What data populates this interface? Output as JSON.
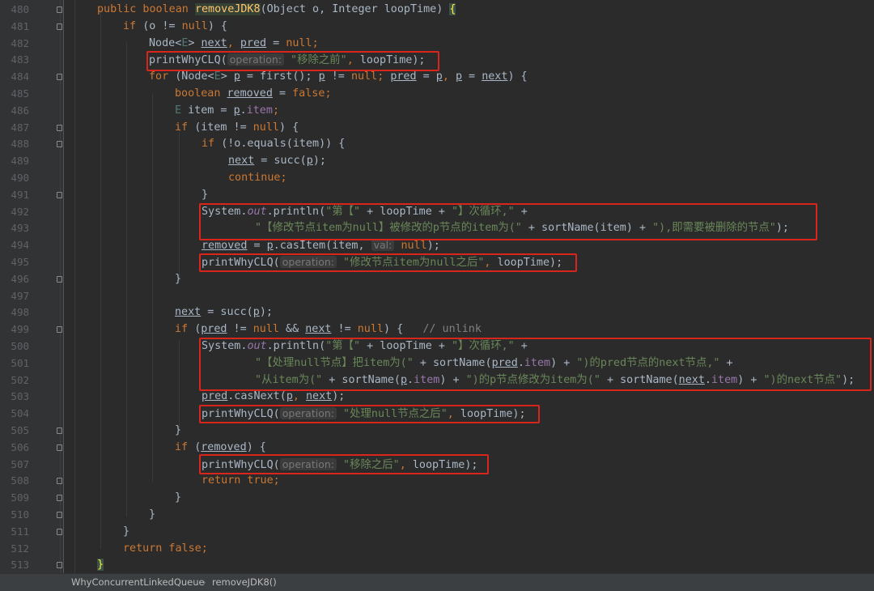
{
  "editor": {
    "lines": [
      {
        "num": "480",
        "segments": [
          {
            "t": "public boolean ",
            "c": "kw"
          },
          {
            "t": "removeJDK8",
            "c": "method hl"
          },
          {
            "t": "(Object o, Integer loopTime) ",
            "c": "ident"
          },
          {
            "t": "{",
            "c": "bracket"
          }
        ]
      },
      {
        "num": "481",
        "segments": [
          {
            "t": "if ",
            "c": "kw"
          },
          {
            "t": "(o != ",
            "c": "ident"
          },
          {
            "t": "null",
            "c": "kw"
          },
          {
            "t": ") {",
            "c": "ident"
          }
        ]
      },
      {
        "num": "482",
        "segments": [
          {
            "t": "Node<",
            "c": "ident"
          },
          {
            "t": "E",
            "c": "generic"
          },
          {
            "t": "> ",
            "c": "ident"
          },
          {
            "t": "next",
            "c": "ident ul"
          },
          {
            "t": ", ",
            "c": "kw"
          },
          {
            "t": "pred",
            "c": "ident ul"
          },
          {
            "t": " = ",
            "c": "ident"
          },
          {
            "t": "null",
            "c": "kw"
          },
          {
            "t": ";",
            "c": "kw"
          }
        ]
      },
      {
        "num": "483",
        "segments": [
          {
            "t": "printWhyCLQ(",
            "c": "ident"
          },
          {
            "t": "operation:",
            "c": "hint"
          },
          {
            "t": " ",
            "c": "ident"
          },
          {
            "t": "\"移除之前\"",
            "c": "str"
          },
          {
            "t": ", ",
            "c": "kw"
          },
          {
            "t": "loopTime);",
            "c": "ident"
          }
        ]
      },
      {
        "num": "484",
        "segments": [
          {
            "t": "for ",
            "c": "kw"
          },
          {
            "t": "(Node<",
            "c": "ident"
          },
          {
            "t": "E",
            "c": "generic"
          },
          {
            "t": "> ",
            "c": "ident"
          },
          {
            "t": "p",
            "c": "ident ul"
          },
          {
            "t": " = first(); ",
            "c": "ident"
          },
          {
            "t": "p",
            "c": "ident ul"
          },
          {
            "t": " != ",
            "c": "ident"
          },
          {
            "t": "null",
            "c": "kw"
          },
          {
            "t": "; ",
            "c": "kw"
          },
          {
            "t": "pred",
            "c": "ident ul"
          },
          {
            "t": " = ",
            "c": "ident"
          },
          {
            "t": "p",
            "c": "ident ul"
          },
          {
            "t": ", ",
            "c": "kw"
          },
          {
            "t": "p",
            "c": "ident ul"
          },
          {
            "t": " = ",
            "c": "ident"
          },
          {
            "t": "next",
            "c": "ident ul"
          },
          {
            "t": ") {",
            "c": "ident"
          }
        ]
      },
      {
        "num": "485",
        "segments": [
          {
            "t": "boolean ",
            "c": "kw"
          },
          {
            "t": "removed",
            "c": "ident ul"
          },
          {
            "t": " = ",
            "c": "ident"
          },
          {
            "t": "false",
            "c": "kw"
          },
          {
            "t": ";",
            "c": "kw"
          }
        ]
      },
      {
        "num": "486",
        "segments": [
          {
            "t": "E ",
            "c": "generic"
          },
          {
            "t": "item = ",
            "c": "ident"
          },
          {
            "t": "p",
            "c": "ident ul"
          },
          {
            "t": ".",
            "c": "ident"
          },
          {
            "t": "item",
            "c": "field"
          },
          {
            "t": ";",
            "c": "kw"
          }
        ]
      },
      {
        "num": "487",
        "segments": [
          {
            "t": "if ",
            "c": "kw"
          },
          {
            "t": "(item != ",
            "c": "ident"
          },
          {
            "t": "null",
            "c": "kw"
          },
          {
            "t": ") {",
            "c": "ident"
          }
        ]
      },
      {
        "num": "488",
        "segments": [
          {
            "t": "if ",
            "c": "kw"
          },
          {
            "t": "(!o.equals(item)) {",
            "c": "ident"
          }
        ]
      },
      {
        "num": "489",
        "segments": [
          {
            "t": "next",
            "c": "ident ul"
          },
          {
            "t": " = succ(",
            "c": "ident"
          },
          {
            "t": "p",
            "c": "ident ul"
          },
          {
            "t": ");",
            "c": "ident"
          }
        ]
      },
      {
        "num": "490",
        "segments": [
          {
            "t": "continue;",
            "c": "kw"
          }
        ]
      },
      {
        "num": "491",
        "segments": [
          {
            "t": "}",
            "c": "ident"
          }
        ]
      },
      {
        "num": "492",
        "segments": [
          {
            "t": "System.",
            "c": "ident"
          },
          {
            "t": "out",
            "c": "italic"
          },
          {
            "t": ".println(",
            "c": "ident"
          },
          {
            "t": "\"第【\"",
            "c": "str"
          },
          {
            "t": " + loopTime + ",
            "c": "ident"
          },
          {
            "t": "\"】次循环,\"",
            "c": "str"
          },
          {
            "t": " +",
            "c": "ident"
          }
        ]
      },
      {
        "num": "493",
        "segments": [
          {
            "t": "\"【修改节点item为null】被修改的p节点的item为(\"",
            "c": "str"
          },
          {
            "t": " + sortName(item) + ",
            "c": "ident"
          },
          {
            "t": "\"),即需要被删除的节点\"",
            "c": "str"
          },
          {
            "t": ");",
            "c": "ident"
          }
        ]
      },
      {
        "num": "494",
        "segments": [
          {
            "t": "removed",
            "c": "ident ul"
          },
          {
            "t": " = ",
            "c": "ident"
          },
          {
            "t": "p",
            "c": "ident ul"
          },
          {
            "t": ".casItem(item, ",
            "c": "ident"
          },
          {
            "t": "val:",
            "c": "hint"
          },
          {
            "t": " ",
            "c": "ident"
          },
          {
            "t": "null",
            "c": "kw"
          },
          {
            "t": ");",
            "c": "ident"
          }
        ]
      },
      {
        "num": "495",
        "segments": [
          {
            "t": "printWhyCLQ(",
            "c": "ident"
          },
          {
            "t": "operation:",
            "c": "hint"
          },
          {
            "t": " ",
            "c": "ident"
          },
          {
            "t": "\"修改节点item为null之后\"",
            "c": "str"
          },
          {
            "t": ", ",
            "c": "kw"
          },
          {
            "t": "loopTime);",
            "c": "ident"
          }
        ]
      },
      {
        "num": "496",
        "segments": [
          {
            "t": "}",
            "c": "ident"
          }
        ]
      },
      {
        "num": "497",
        "segments": []
      },
      {
        "num": "498",
        "segments": [
          {
            "t": "next",
            "c": "ident ul"
          },
          {
            "t": " = succ(",
            "c": "ident"
          },
          {
            "t": "p",
            "c": "ident ul"
          },
          {
            "t": ");",
            "c": "ident"
          }
        ]
      },
      {
        "num": "499",
        "segments": [
          {
            "t": "if ",
            "c": "kw"
          },
          {
            "t": "(",
            "c": "ident"
          },
          {
            "t": "pred",
            "c": "ident ul"
          },
          {
            "t": " != ",
            "c": "ident"
          },
          {
            "t": "null",
            "c": "kw"
          },
          {
            "t": " && ",
            "c": "ident"
          },
          {
            "t": "next",
            "c": "ident ul"
          },
          {
            "t": " != ",
            "c": "ident"
          },
          {
            "t": "null",
            "c": "kw"
          },
          {
            "t": ") {   ",
            "c": "ident"
          },
          {
            "t": "// unlink",
            "c": "comment"
          }
        ]
      },
      {
        "num": "500",
        "segments": [
          {
            "t": "System.",
            "c": "ident"
          },
          {
            "t": "out",
            "c": "italic"
          },
          {
            "t": ".println(",
            "c": "ident"
          },
          {
            "t": "\"第【\"",
            "c": "str"
          },
          {
            "t": " + loopTime + ",
            "c": "ident"
          },
          {
            "t": "\"】次循环,\"",
            "c": "str"
          },
          {
            "t": " +",
            "c": "ident"
          }
        ]
      },
      {
        "num": "501",
        "segments": [
          {
            "t": "\"【处理null节点】把item为(\"",
            "c": "str"
          },
          {
            "t": " + sortName(",
            "c": "ident"
          },
          {
            "t": "pred",
            "c": "ident ul"
          },
          {
            "t": ".",
            "c": "ident"
          },
          {
            "t": "item",
            "c": "field"
          },
          {
            "t": ") + ",
            "c": "ident"
          },
          {
            "t": "\")的pred节点的next节点,\"",
            "c": "str"
          },
          {
            "t": " +",
            "c": "ident"
          }
        ]
      },
      {
        "num": "502",
        "segments": [
          {
            "t": "\"从item为(\"",
            "c": "str"
          },
          {
            "t": " + sortName(",
            "c": "ident"
          },
          {
            "t": "p",
            "c": "ident ul"
          },
          {
            "t": ".",
            "c": "ident"
          },
          {
            "t": "item",
            "c": "field"
          },
          {
            "t": ") + ",
            "c": "ident"
          },
          {
            "t": "\")的p节点修改为item为(\"",
            "c": "str"
          },
          {
            "t": " + sortName(",
            "c": "ident"
          },
          {
            "t": "next",
            "c": "ident ul"
          },
          {
            "t": ".",
            "c": "ident"
          },
          {
            "t": "item",
            "c": "field"
          },
          {
            "t": ") + ",
            "c": "ident"
          },
          {
            "t": "\")的next节点\"",
            "c": "str"
          },
          {
            "t": ");",
            "c": "ident"
          }
        ]
      },
      {
        "num": "503",
        "segments": [
          {
            "t": "pred",
            "c": "ident ul"
          },
          {
            "t": ".casNext(",
            "c": "ident"
          },
          {
            "t": "p",
            "c": "ident ul"
          },
          {
            "t": ", ",
            "c": "kw"
          },
          {
            "t": "next",
            "c": "ident ul"
          },
          {
            "t": ");",
            "c": "ident"
          }
        ]
      },
      {
        "num": "504",
        "segments": [
          {
            "t": "printWhyCLQ(",
            "c": "ident"
          },
          {
            "t": "operation:",
            "c": "hint"
          },
          {
            "t": " ",
            "c": "ident"
          },
          {
            "t": "\"处理null节点之后\"",
            "c": "str"
          },
          {
            "t": ", ",
            "c": "kw"
          },
          {
            "t": "loopTime);",
            "c": "ident"
          }
        ]
      },
      {
        "num": "505",
        "segments": [
          {
            "t": "}",
            "c": "ident"
          }
        ]
      },
      {
        "num": "506",
        "segments": [
          {
            "t": "if ",
            "c": "kw"
          },
          {
            "t": "(",
            "c": "ident"
          },
          {
            "t": "removed",
            "c": "ident ul"
          },
          {
            "t": ") {",
            "c": "ident"
          }
        ]
      },
      {
        "num": "507",
        "segments": [
          {
            "t": "printWhyCLQ(",
            "c": "ident"
          },
          {
            "t": "operation:",
            "c": "hint"
          },
          {
            "t": " ",
            "c": "ident"
          },
          {
            "t": "\"移除之后\"",
            "c": "str"
          },
          {
            "t": ", ",
            "c": "kw"
          },
          {
            "t": "loopTime);",
            "c": "ident"
          }
        ]
      },
      {
        "num": "508",
        "segments": [
          {
            "t": "return true;",
            "c": "kw"
          }
        ]
      },
      {
        "num": "509",
        "segments": [
          {
            "t": "}",
            "c": "ident"
          }
        ]
      },
      {
        "num": "510",
        "segments": [
          {
            "t": "}",
            "c": "ident"
          }
        ]
      },
      {
        "num": "511",
        "segments": [
          {
            "t": "}",
            "c": "ident"
          }
        ]
      },
      {
        "num": "512",
        "segments": [
          {
            "t": "return false;",
            "c": "kw"
          }
        ]
      },
      {
        "num": "513",
        "segments": [
          {
            "t": "}",
            "c": "bracket"
          }
        ]
      }
    ]
  },
  "breadcrumb": {
    "class_name": "WhyConcurrentLinkedQueue",
    "separator": "›",
    "method_name": "removeJDK8()"
  },
  "colors": {
    "background": "#2b2b2b",
    "gutter": "#313335",
    "keyword": "#cc7832",
    "string": "#6a8759",
    "field": "#9876aa",
    "comment": "#808080",
    "highlight_box": "#d9261c"
  }
}
